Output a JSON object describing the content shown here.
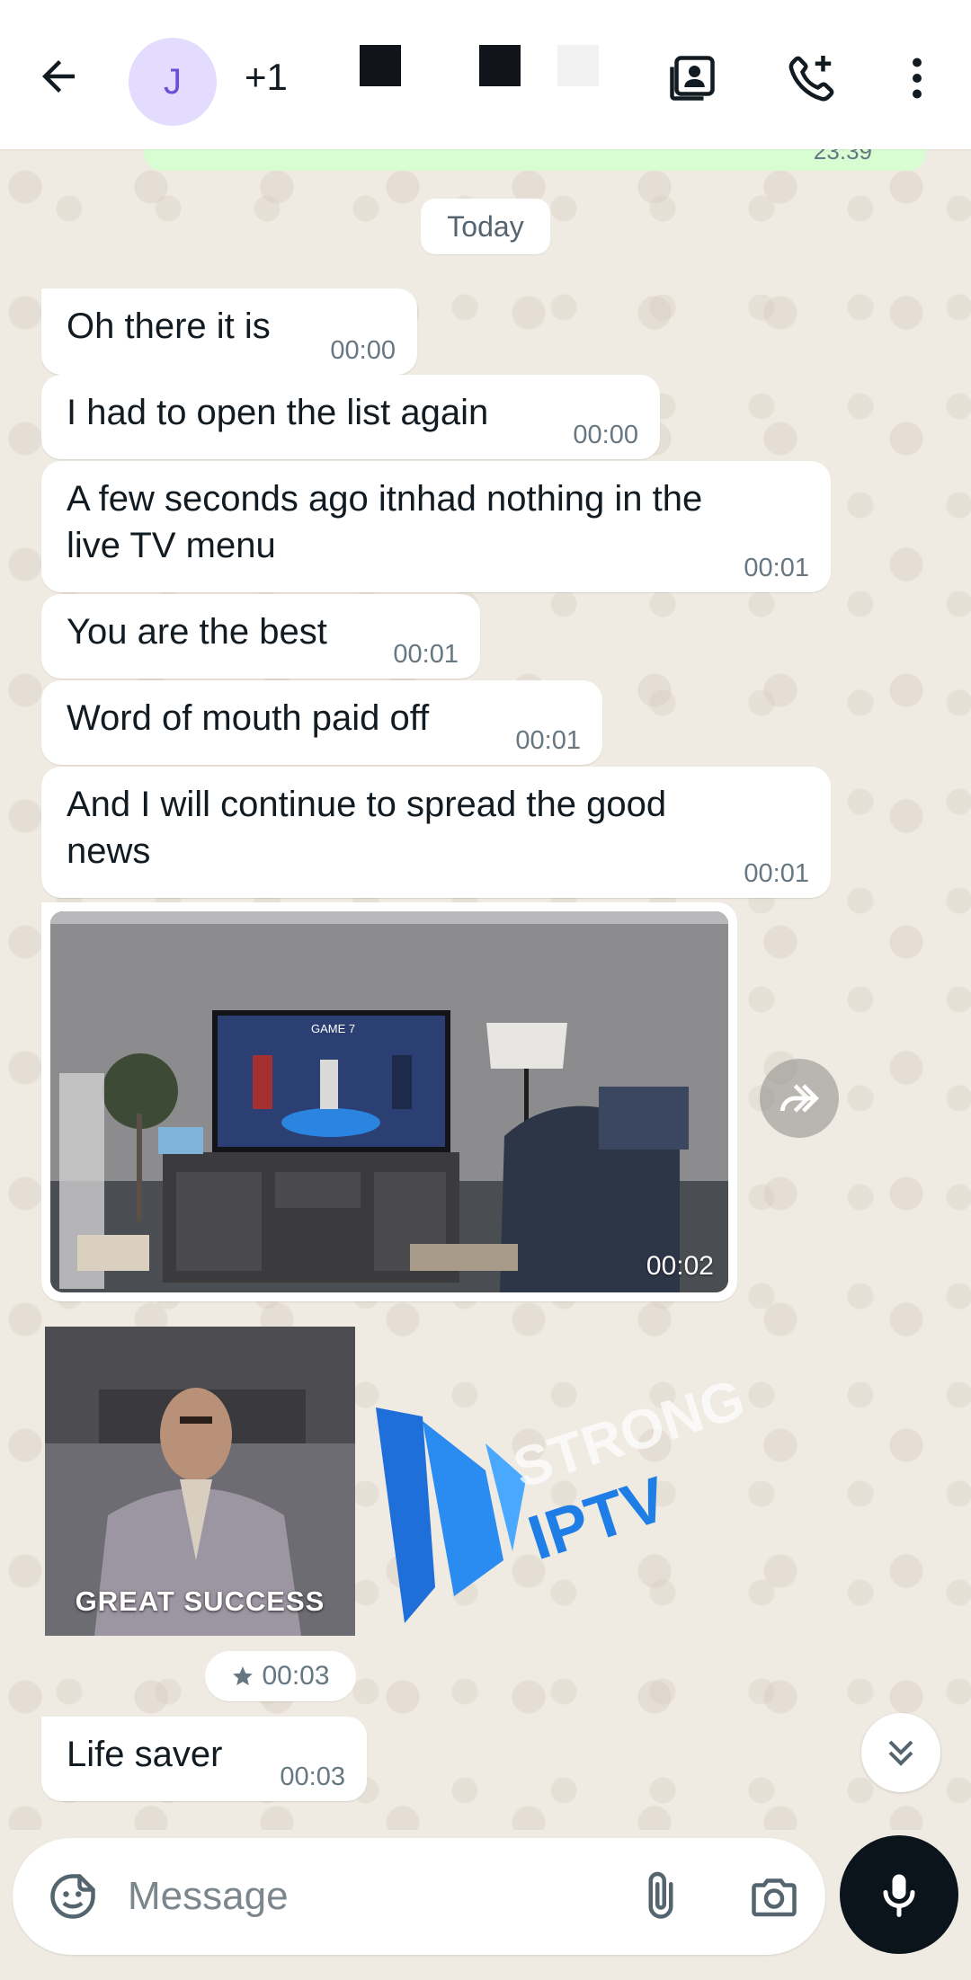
{
  "header": {
    "avatar_letter": "J",
    "participants_extra": "+1",
    "icons": [
      "back-arrow-icon",
      "contact-card-icon",
      "add-call-icon",
      "more-vert-icon"
    ]
  },
  "chat": {
    "prev_time": "23:39",
    "date_divider": "Today",
    "messages": [
      {
        "text": "Oh there it is",
        "time": "00:00"
      },
      {
        "text": "I had to open the list again",
        "time": "00:00"
      },
      {
        "text": "A few seconds ago itnhad nothing in the live TV menu",
        "line1": "A few seconds ago itnhad nothing in the",
        "line2": "live TV menu",
        "time": "00:01"
      },
      {
        "text": "You are the best",
        "time": "00:01"
      },
      {
        "text": "Word of mouth paid off",
        "time": "00:01"
      },
      {
        "text": "And I will continue to spread the good news",
        "line1": "And I will continue to spread the good",
        "line2": "news",
        "time": "00:01"
      }
    ],
    "media": {
      "time": "00:02",
      "tv_label": "GAME 7"
    },
    "sticker": {
      "caption": "GREAT SUCCESS",
      "time": "00:03",
      "starred": true
    },
    "watermark": {
      "top": "STRONG",
      "bottom": "IPTV"
    },
    "last_message": {
      "text": "Life saver",
      "time": "00:03"
    }
  },
  "composer": {
    "placeholder": "Message"
  },
  "colors": {
    "chat_bg": "#efeae2",
    "bubble_in": "#ffffff",
    "bubble_out": "#d9fdd3",
    "avatar_bg": "#e3dcff",
    "avatar_fg": "#6a4fd8",
    "mic_bg": "#0b141a",
    "timestamp": "#667781"
  }
}
